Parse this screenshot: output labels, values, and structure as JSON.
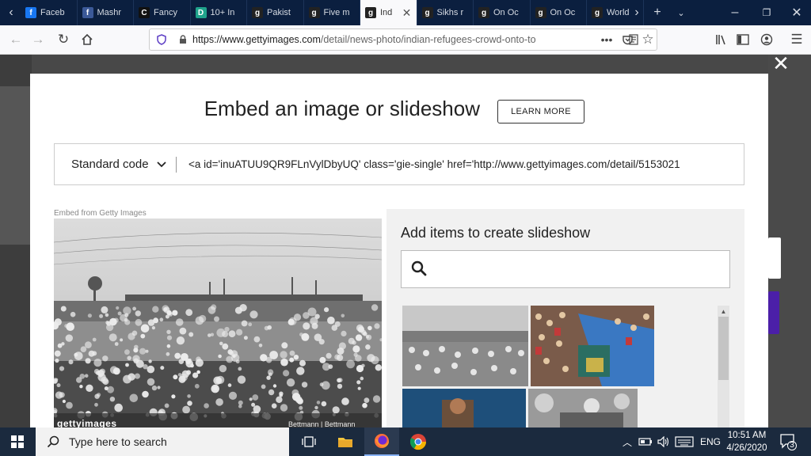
{
  "browser": {
    "tabs": [
      {
        "label": "Faceb",
        "fav": "f",
        "fav_color": "#1877f2"
      },
      {
        "label": "Mashr",
        "fav": "f",
        "fav_color": "#3b5998"
      },
      {
        "label": "Fancy",
        "fav": "C",
        "fav_color": "#111111"
      },
      {
        "label": "10+ In",
        "fav": "D",
        "fav_color": "#1fa38c"
      },
      {
        "label": "Pakist",
        "fav": "g",
        "fav_color": "#222222"
      },
      {
        "label": "Five m",
        "fav": "g",
        "fav_color": "#222222"
      },
      {
        "label": "Ind",
        "fav": "g",
        "fav_color": "#222222"
      },
      {
        "label": "Sikhs r",
        "fav": "g",
        "fav_color": "#222222"
      },
      {
        "label": "On Oc",
        "fav": "g",
        "fav_color": "#222222"
      },
      {
        "label": "On Oc",
        "fav": "g",
        "fav_color": "#222222"
      },
      {
        "label": "World",
        "fav": "g",
        "fav_color": "#222222"
      }
    ],
    "url_host": "https://www.gettyimages.com",
    "url_path": "/detail/news-photo/indian-refugees-crowd-onto-to"
  },
  "modal": {
    "title": "Embed an image or slideshow",
    "learn_more": "LEARN MORE",
    "code_type": "Standard code",
    "code_snippet": "<a id='inuATUU9QR9FLnVylDbyUQ' class='gie-single' href='http://www.gettyimages.com/detail/5153021",
    "embed_from": "Embed from Getty Images",
    "watermark": "gettyimages",
    "credit": "Bettmann | Bettmann",
    "slideshow_title": "Add items to create slideshow",
    "search_placeholder": ""
  },
  "taskbar": {
    "search_placeholder": "Type here to search",
    "language": "ENG",
    "time": "10:51 AM",
    "date": "4/26/2020",
    "notifications": "3"
  },
  "colors": {
    "tabbar": "#0b1f3f",
    "taskbar": "#1b2a3e",
    "accent_purple": "#4b1fa8"
  }
}
